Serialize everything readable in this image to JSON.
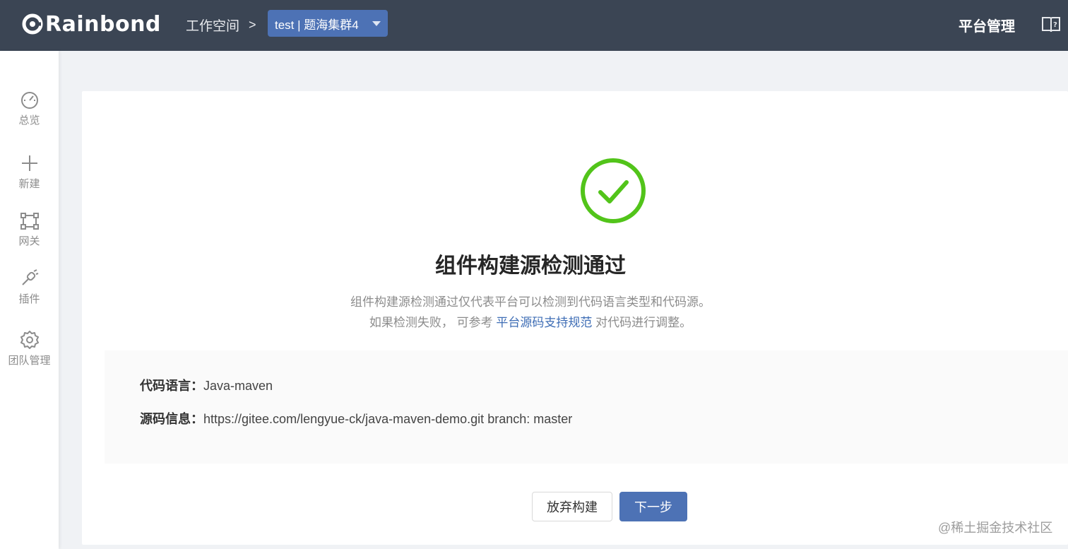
{
  "header": {
    "logo_text": "Rainbond",
    "breadcrumb_workspace": "工作空间",
    "breadcrumb_separator": ">",
    "team_select_value": "test | 题海集群4",
    "platform_admin": "平台管理"
  },
  "sidebar": {
    "items": [
      {
        "label": "总览",
        "icon": "dashboard-icon"
      },
      {
        "label": "新建",
        "icon": "plus-icon"
      },
      {
        "label": "网关",
        "icon": "gateway-icon"
      },
      {
        "label": "插件",
        "icon": "plugin-icon"
      },
      {
        "label": "团队管理",
        "icon": "gear-icon"
      }
    ]
  },
  "main": {
    "title": "组件构建源检测通过",
    "desc_line1": "组件构建源检测通过仅代表平台可以检测到代码语言类型和代码源。",
    "desc_line2_prefix": "如果检测失败， 可参考 ",
    "desc_line2_link": "平台源码支持规范",
    "desc_line2_suffix": " 对代码进行调整。",
    "info": {
      "language_label": "代码语言：",
      "language_value": "Java-maven",
      "source_label": "源码信息：",
      "source_value": "https://gitee.com/lengyue-ck/java-maven-demo.git branch: master"
    },
    "buttons": {
      "abandon": "放弃构建",
      "next": "下一步"
    }
  },
  "watermark": "@稀土掘金技术社区",
  "colors": {
    "header_bg": "#3b4554",
    "accent": "#4d72b5",
    "success": "#52c41a"
  }
}
